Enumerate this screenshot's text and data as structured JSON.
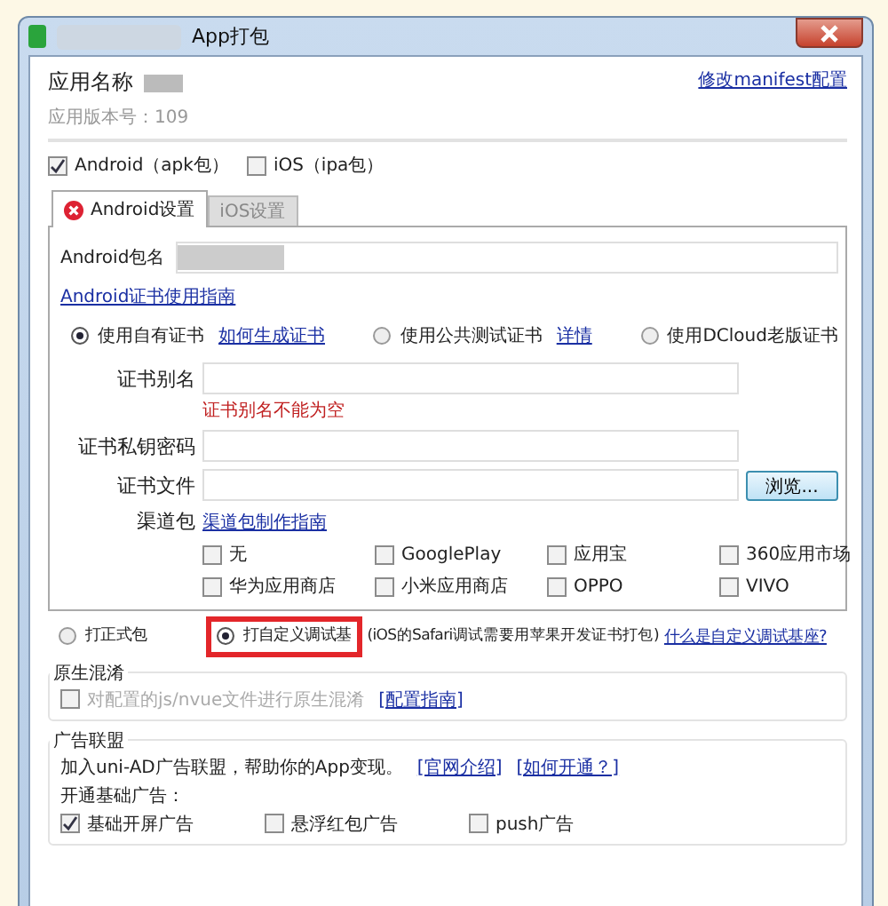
{
  "window": {
    "title": "App打包"
  },
  "app": {
    "name_label": "应用名称",
    "version": "应用版本号：109",
    "manifest_link": "修改manifest配置"
  },
  "platforms": [
    {
      "label": "Android（apk包）",
      "checked": true
    },
    {
      "label": "iOS（ipa包）",
      "checked": false
    }
  ],
  "tabs": [
    {
      "label": "Android设置",
      "selected": true,
      "error": true
    },
    {
      "label": "iOS设置",
      "selected": false,
      "error": false
    }
  ],
  "android": {
    "package_label": "Android包名",
    "cert_guide_link": "Android证书使用指南",
    "cert_options": [
      {
        "label": "使用自有证书",
        "link": "如何生成证书",
        "selected": true
      },
      {
        "label": "使用公共测试证书",
        "link": "详情",
        "selected": false
      },
      {
        "label": "使用DCloud老版证书",
        "selected": false
      }
    ],
    "fields": [
      {
        "label": "证书别名",
        "error": "证书别名不能为空"
      },
      {
        "label": "证书私钥密码"
      },
      {
        "label": "证书文件",
        "button": "浏览..."
      }
    ],
    "channel_label": "渠道包",
    "channel_link": "渠道包制作指南",
    "channels": [
      {
        "label": "无",
        "checked": false
      },
      {
        "label": "GooglePlay",
        "checked": false
      },
      {
        "label": "应用宝",
        "checked": false
      },
      {
        "label": "360应用市场",
        "checked": false
      },
      {
        "label": "华为应用商店",
        "checked": false
      },
      {
        "label": "小米应用商店",
        "checked": false
      },
      {
        "label": "OPPO",
        "checked": false
      },
      {
        "label": "VIVO",
        "checked": false
      }
    ]
  },
  "build_types": [
    {
      "label": "打正式包",
      "selected": false,
      "highlighted": false
    },
    {
      "label": "打自定义调试基",
      "selected": true,
      "highlighted": true
    }
  ],
  "build_note": "(iOS的Safari调试需要用苹果开发证书打包)",
  "build_link": "什么是自定义调试基座?",
  "obfuscation": {
    "title": "原生混淆",
    "label": "对配置的js/nvue文件进行原生混淆",
    "checked": false,
    "disabled": true,
    "link": "[配置指南]"
  },
  "ads": {
    "title": "广告联盟",
    "intro": "加入uni-AD广告联盟，帮助你的App变现。",
    "links": [
      "[官网介绍]",
      "[如何开通？]"
    ],
    "basic_label": "开通基础广告：",
    "items": [
      {
        "label": "基础开屏广告",
        "checked": true
      },
      {
        "label": "悬浮红包广告",
        "checked": false
      },
      {
        "label": "push广告",
        "checked": false
      }
    ]
  }
}
